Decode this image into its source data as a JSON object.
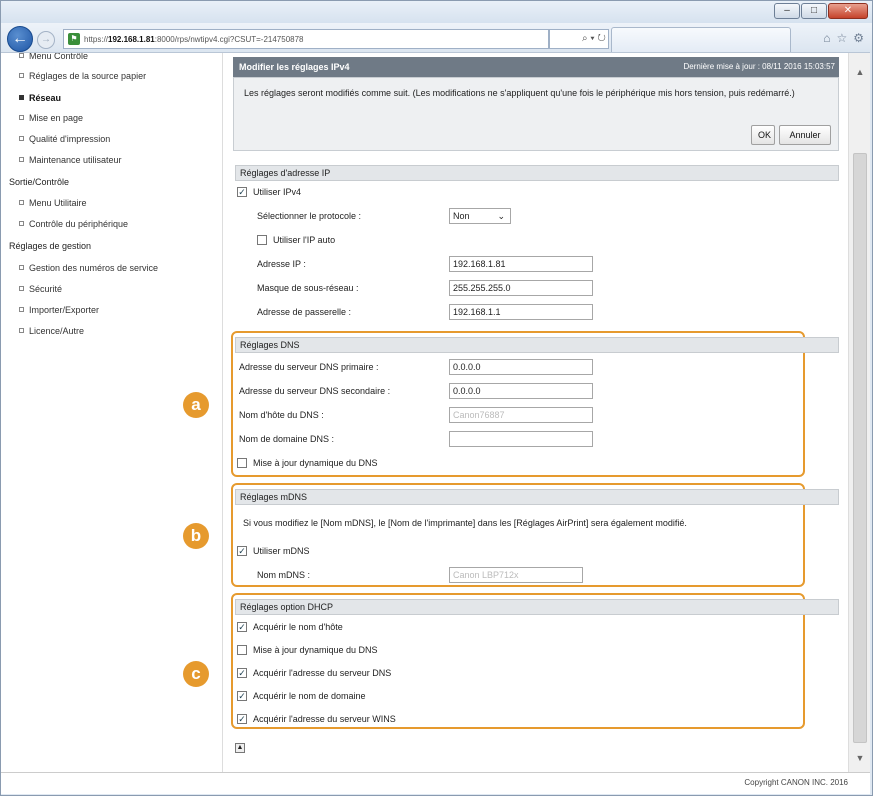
{
  "browser": {
    "url_prefix": "https://",
    "url_host": "192.168.1.81",
    "url_rest": ":8000/rps/nwtipv4.cgi?CSUT=-214750878",
    "search_glyph": "⌕ ▾ ↻",
    "back_glyph": "←",
    "forward_glyph": "→",
    "window_buttons": [
      "–",
      "□",
      "✕"
    ],
    "tool_icons": [
      "⌂",
      "☆",
      "⚙"
    ]
  },
  "sidebar": {
    "items_top": [
      {
        "label": "Menu Contrôle"
      },
      {
        "label": "Réglages de la source papier"
      },
      {
        "label": "Réseau",
        "active": true
      },
      {
        "label": "Mise en page"
      },
      {
        "label": "Qualité d'impression"
      },
      {
        "label": "Maintenance utilisateur"
      }
    ],
    "group_output": "Sortie/Contrôle",
    "items_output": [
      {
        "label": "Menu Utilitaire"
      },
      {
        "label": "Contrôle du périphérique"
      }
    ],
    "group_mgmt": "Réglages de gestion",
    "items_mgmt": [
      {
        "label": "Gestion des numéros de service"
      },
      {
        "label": "Sécurité"
      },
      {
        "label": "Importer/Exporter"
      },
      {
        "label": "Licence/Autre"
      }
    ]
  },
  "header": {
    "title": "Modifier les réglages IPv4",
    "last_updated": "Dernière mise à jour : 08/11 2016 15:03:57"
  },
  "notice": {
    "text": "Les réglages seront modifiés comme suit. (Les modifications ne s'appliquent qu'une fois le périphérique mis hors tension, puis redémarré.)",
    "ok_label": "OK",
    "cancel_label": "Annuler"
  },
  "ip": {
    "title": "Réglages d'adresse IP",
    "use_ipv4_label": "Utiliser IPv4",
    "use_ipv4_checked": true,
    "protocol_label": "Sélectionner le protocole :",
    "protocol_value": "Non",
    "auto_ip_label": "Utiliser l'IP auto",
    "auto_ip_checked": false,
    "address_label": "Adresse IP :",
    "address_value": "192.168.1.81",
    "mask_label": "Masque de sous-réseau :",
    "mask_value": "255.255.255.0",
    "gateway_label": "Adresse de passerelle :",
    "gateway_value": "192.168.1.1"
  },
  "dns": {
    "title": "Réglages DNS",
    "primary_label": "Adresse du serveur DNS primaire :",
    "primary_value": "0.0.0.0",
    "secondary_label": "Adresse du serveur DNS secondaire :",
    "secondary_value": "0.0.0.0",
    "host_label": "Nom d'hôte du DNS :",
    "host_value": "Canon76887",
    "domain_label": "Nom de domaine DNS :",
    "domain_value": "",
    "dynamic_label": "Mise à jour dynamique du DNS",
    "dynamic_checked": false,
    "badge": "a"
  },
  "mdns": {
    "title": "Réglages mDNS",
    "note": "Si vous modifiez le [Nom mDNS], le [Nom de l'imprimante] dans les [Réglages AirPrint] sera également modifié.",
    "use_label": "Utiliser mDNS",
    "use_checked": true,
    "name_label": "Nom mDNS :",
    "name_value": "Canon LBP712x",
    "badge": "b"
  },
  "dhcp": {
    "title": "Réglages option DHCP",
    "options": [
      {
        "label": "Acquérir le nom d'hôte",
        "checked": true
      },
      {
        "label": "Mise à jour dynamique du DNS",
        "checked": false
      },
      {
        "label": "Acquérir l'adresse du serveur DNS",
        "checked": true
      },
      {
        "label": "Acquérir le nom de domaine",
        "checked": true
      },
      {
        "label": "Acquérir l'adresse du serveur WINS",
        "checked": true
      }
    ],
    "badge": "c"
  },
  "footer": {
    "copyright": "Copyright CANON INC. 2016"
  },
  "colors": {
    "highlight": "#e69a2e",
    "header_bar": "#6f7a86",
    "back_button": "#1f56a5"
  }
}
